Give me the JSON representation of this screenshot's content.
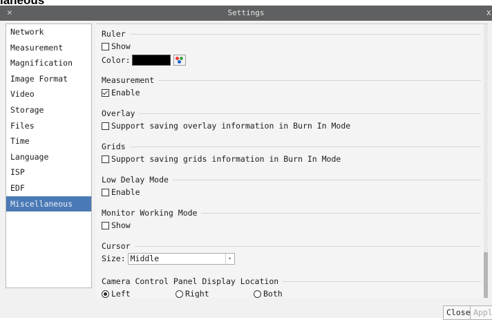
{
  "top_fragment": "laneous",
  "window": {
    "title": "Settings",
    "close_glyph": "x"
  },
  "sidebar": {
    "items": [
      {
        "label": "Network"
      },
      {
        "label": "Measurement"
      },
      {
        "label": "Magnification"
      },
      {
        "label": "Image Format"
      },
      {
        "label": "Video"
      },
      {
        "label": "Storage"
      },
      {
        "label": "Files"
      },
      {
        "label": "Time"
      },
      {
        "label": "Language"
      },
      {
        "label": "ISP"
      },
      {
        "label": "EDF"
      },
      {
        "label": "Miscellaneous"
      }
    ],
    "active": "Miscellaneous"
  },
  "sections": {
    "ruler": {
      "title": "Ruler",
      "show_label": "Show",
      "show_checked": false,
      "color_label": "Color:",
      "color_value": "#000000"
    },
    "measurement": {
      "title": "Measurement",
      "enable_label": "Enable",
      "enable_checked": true
    },
    "overlay": {
      "title": "Overlay",
      "option_label": "Support saving overlay information in Burn In Mode",
      "checked": false
    },
    "grids": {
      "title": "Grids",
      "option_label": "Support saving grids information in Burn In Mode",
      "checked": false
    },
    "low_delay": {
      "title": "Low Delay Mode",
      "enable_label": "Enable",
      "checked": false
    },
    "monitor": {
      "title": "Monitor Working Mode",
      "show_label": "Show",
      "checked": false
    },
    "cursor": {
      "title": "Cursor",
      "size_label": "Size:",
      "size_value": "Middle"
    },
    "camera_panel": {
      "title": "Camera Control Panel Display Location",
      "options": [
        "Left",
        "Right",
        "Both"
      ],
      "selected": "Left"
    }
  },
  "buttons": {
    "close": "Close",
    "apply": "Appl"
  },
  "colors": {
    "titlebar": "#5f6061",
    "active_item": "#4a7ab5",
    "dialog_bg": "#f1f1f1"
  }
}
